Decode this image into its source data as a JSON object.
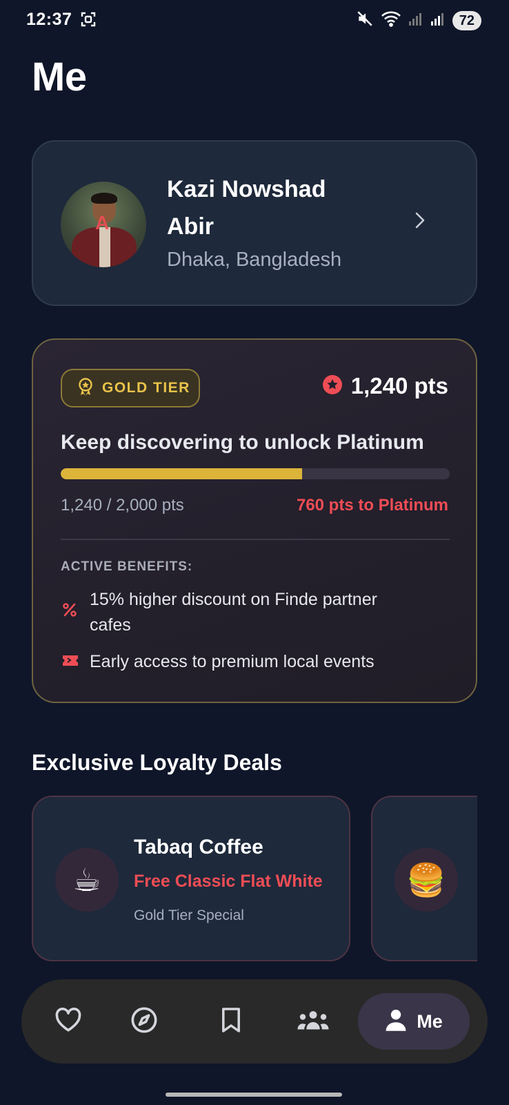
{
  "status_bar": {
    "time": "12:37",
    "battery": "72"
  },
  "page": {
    "title": "Me"
  },
  "profile": {
    "name": "Kazi Nowshad Abir",
    "location": "Dhaka, Bangladesh"
  },
  "tier": {
    "badge_label": "GOLD TIER",
    "points_label": "1,240 pts",
    "headline": "Keep discovering to unlock Platinum",
    "progress_caption": "1,240 / 2,000 pts",
    "progress_fraction": 0.62,
    "remaining": "760 pts to Platinum",
    "benefits_heading": "ACTIVE BENEFITS:",
    "benefits": [
      {
        "icon": "percent-icon",
        "text": "15% higher discount on Finde partner cafes"
      },
      {
        "icon": "ticket-icon",
        "text": "Early access to premium local events"
      }
    ],
    "accent_gold": "#dcb43a",
    "accent_red": "#ef4d55"
  },
  "deals": {
    "title": "Exclusive Loyalty Deals",
    "items": [
      {
        "emoji": "☕",
        "name": "Tabaq Coffee",
        "offer": "Free Classic Flat White",
        "tag": "Gold Tier Special"
      },
      {
        "emoji": "🍔",
        "name": "",
        "offer": "",
        "tag": ""
      }
    ]
  },
  "nav": {
    "items": [
      {
        "icon": "heart-icon"
      },
      {
        "icon": "compass-icon"
      },
      {
        "icon": "bookmark-icon"
      },
      {
        "icon": "people-icon"
      },
      {
        "icon": "person-icon",
        "label": "Me",
        "active": true
      }
    ]
  }
}
